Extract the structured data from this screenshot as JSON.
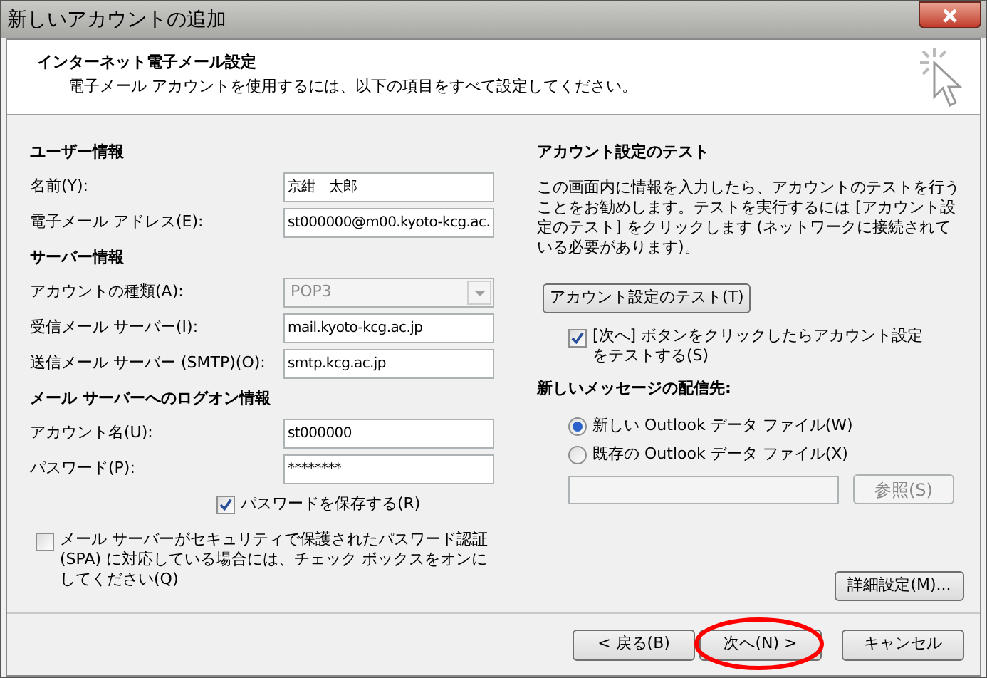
{
  "window": {
    "title": "新しいアカウントの追加"
  },
  "header": {
    "title": "インターネット電子メール設定",
    "subtitle": "電子メール アカウントを使用するには、以下の項目をすべて設定してください。"
  },
  "left_sections": [
    {
      "heading": "ユーザー情報",
      "fields": [
        {
          "kind": "text",
          "label": "名前(Y):",
          "value": "京紺　太郎",
          "disabled": false
        },
        {
          "kind": "text",
          "label": "電子メール アドレス(E):",
          "value": "st000000@m00.kyoto-kcg.ac.",
          "disabled": false
        }
      ]
    },
    {
      "heading": "サーバー情報",
      "fields": [
        {
          "kind": "select",
          "label": "アカウントの種類(A):",
          "value": "POP3",
          "disabled": true
        },
        {
          "kind": "text",
          "label": "受信メール サーバー(I):",
          "value": "mail.kyoto-kcg.ac.jp",
          "disabled": false
        },
        {
          "kind": "text",
          "label": "送信メール サーバー (SMTP)(O):",
          "value": "smtp.kcg.ac.jp",
          "disabled": false
        }
      ]
    },
    {
      "heading": "メール サーバーへのログオン情報",
      "fields": [
        {
          "kind": "text",
          "label": "アカウント名(U):",
          "value": "st000000",
          "disabled": false
        },
        {
          "kind": "text",
          "label": "パスワード(P):",
          "value": "********",
          "disabled": false
        }
      ]
    }
  ],
  "save_password": {
    "label": "パスワードを保存する(R)",
    "checked": true
  },
  "spa": {
    "label": "メール サーバーがセキュリティで保護されたパスワード認証 (SPA) に対応している場合には、チェック ボックスをオンにしてください(Q)",
    "checked": false
  },
  "test": {
    "heading": "アカウント設定のテスト",
    "description": "この画面内に情報を入力したら、アカウントのテストを行うことをお勧めします。テストを実行するには [アカウント設定のテスト] をクリックします (ネットワークに接続されている必要があります)。",
    "button": "アカウント設定のテスト(T)",
    "auto_test": {
      "label": "[次へ] ボタンをクリックしたらアカウント設定をテストする(S)",
      "checked": true
    }
  },
  "delivery": {
    "heading": "新しいメッセージの配信先:",
    "options": [
      {
        "label": "新しい Outlook データ ファイル(W)",
        "selected": true
      },
      {
        "label": "既存の Outlook データ ファイル(X)",
        "selected": false
      }
    ],
    "browse_button": {
      "label": "参照(S)",
      "disabled": true
    }
  },
  "more_settings_button": "詳細設定(M)...",
  "buttons": [
    {
      "label": "< 戻る(B)",
      "circled": false
    },
    {
      "label": "次へ(N) >",
      "circled": true
    },
    {
      "label": "キャンセル",
      "circled": false
    }
  ]
}
